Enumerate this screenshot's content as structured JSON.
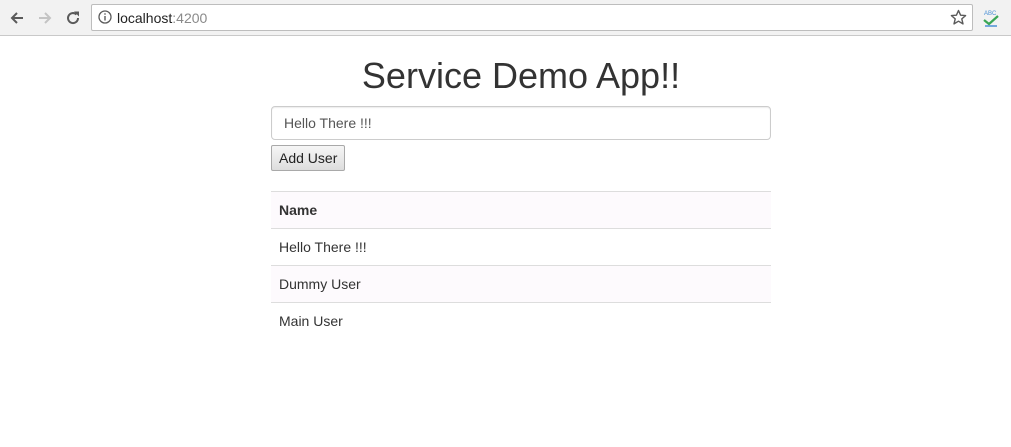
{
  "browser": {
    "url_host": "localhost",
    "url_port": ":4200"
  },
  "app": {
    "title": "Service Demo App!!",
    "input_value": "Hello There !!!",
    "add_button_label": "Add User"
  },
  "table": {
    "header": "Name",
    "rows": [
      "Hello There !!!",
      "Dummy User",
      "Main User"
    ]
  }
}
